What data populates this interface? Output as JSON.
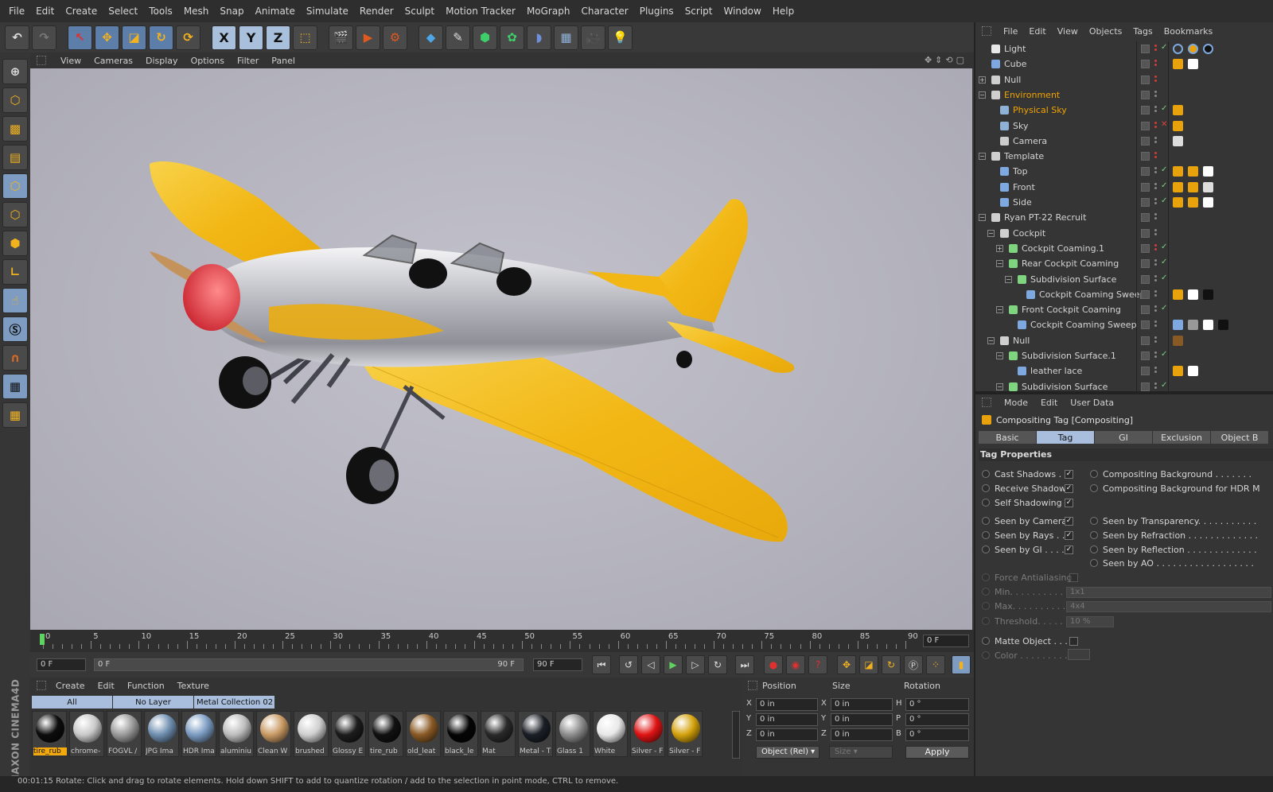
{
  "menubar": {
    "items": [
      "File",
      "Edit",
      "Create",
      "Select",
      "Tools",
      "Mesh",
      "Snap",
      "Animate",
      "Simulate",
      "Render",
      "Sculpt",
      "Motion Tracker",
      "MoGraph",
      "Character",
      "Plugins",
      "Script",
      "Window",
      "Help"
    ]
  },
  "toolbar": {
    "axes": [
      "X",
      "Y",
      "Z"
    ]
  },
  "brand": "MAXON CINEMA4D",
  "viewport": {
    "menu": [
      "View",
      "Cameras",
      "Display",
      "Options",
      "Filter",
      "Panel"
    ]
  },
  "timeline": {
    "ticks": [
      "0",
      "5",
      "10",
      "15",
      "20",
      "25",
      "30",
      "35",
      "40",
      "45",
      "50",
      "55",
      "60",
      "65",
      "70",
      "75",
      "80",
      "85",
      "90"
    ],
    "current_frame": "0 F"
  },
  "transport": {
    "start": "0 F",
    "slider_start": "0 F",
    "slider_end": "90 F",
    "end": "90 F"
  },
  "materials": {
    "menu": [
      "Create",
      "Edit",
      "Function",
      "Texture"
    ],
    "tabs": [
      "All",
      "No Layer",
      "Metal Collection 02"
    ],
    "items": [
      {
        "name": "tire_rub",
        "color": "#0d0d0d"
      },
      {
        "name": "chrome-",
        "color": "#c9c9c9"
      },
      {
        "name": "FOGVL /",
        "color": "#9a9a9a"
      },
      {
        "name": "JPG Ima",
        "color": "#6f8fb0"
      },
      {
        "name": "HDR Ima",
        "color": "#7b9cc2"
      },
      {
        "name": "aluminiu",
        "color": "#bdbdbd"
      },
      {
        "name": "Clean W",
        "color": "#c99a64"
      },
      {
        "name": "brushed",
        "color": "#cfcfcf"
      },
      {
        "name": "Glossy E",
        "color": "#1d1d1d"
      },
      {
        "name": "tire_rub",
        "color": "#111"
      },
      {
        "name": "old_leat",
        "color": "#8a5a25"
      },
      {
        "name": "black_le",
        "color": "#050505"
      },
      {
        "name": "Mat",
        "color": "#2a2a2a"
      },
      {
        "name": "Metal - T",
        "color": "#1b1f26"
      },
      {
        "name": "Glass 1",
        "color": "#8d8d8d"
      },
      {
        "name": "White",
        "color": "#e8e8e8"
      },
      {
        "name": "Silver - F",
        "color": "#e01414"
      },
      {
        "name": "Silver - F",
        "color": "#d4a20c"
      }
    ]
  },
  "coords": {
    "headers": [
      "Position",
      "Size",
      "Rotation"
    ],
    "rows": [
      {
        "a": "X",
        "av": "0 in",
        "b": "X",
        "bv": "0 in",
        "c": "H",
        "cv": "0 °"
      },
      {
        "a": "Y",
        "av": "0 in",
        "b": "Y",
        "bv": "0 in",
        "c": "P",
        "cv": "0 °"
      },
      {
        "a": "Z",
        "av": "0 in",
        "b": "Z",
        "bv": "0 in",
        "c": "B",
        "cv": "0 °"
      }
    ],
    "mode": "Object (Rel)",
    "size_mode": "Size",
    "apply": "Apply"
  },
  "status": "00:01:15   Rotate: Click and drag to rotate elements. Hold down SHIFT to add to quantize rotation / add to the selection in point mode, CTRL to remove.",
  "objects": {
    "menu": [
      "File",
      "Edit",
      "View",
      "Objects",
      "Tags",
      "Bookmarks"
    ],
    "rows": [
      {
        "name": "Light",
        "indent": 0,
        "icon": "#e8e8e8",
        "hl": false,
        "exp": ""
      },
      {
        "name": "Cube",
        "indent": 0,
        "icon": "#7ea9e0",
        "hl": false,
        "exp": ""
      },
      {
        "name": "Null",
        "indent": 0,
        "icon": "#cfcfcf",
        "hl": false,
        "exp": "+"
      },
      {
        "name": "Environment",
        "indent": 0,
        "icon": "#cfcfcf",
        "hl": true,
        "exp": "-"
      },
      {
        "name": "Physical Sky",
        "indent": 1,
        "icon": "#8fb1d6",
        "hl": true,
        "exp": ""
      },
      {
        "name": "Sky",
        "indent": 1,
        "icon": "#8fb1d6",
        "hl": false,
        "exp": ""
      },
      {
        "name": "Camera",
        "indent": 1,
        "icon": "#cccccc",
        "hl": false,
        "exp": ""
      },
      {
        "name": "Template",
        "indent": 0,
        "icon": "#cfcfcf",
        "hl": false,
        "exp": "-"
      },
      {
        "name": "Top",
        "indent": 1,
        "icon": "#7ea9e0",
        "hl": false,
        "exp": ""
      },
      {
        "name": "Front",
        "indent": 1,
        "icon": "#7ea9e0",
        "hl": false,
        "exp": ""
      },
      {
        "name": "Side",
        "indent": 1,
        "icon": "#7ea9e0",
        "hl": false,
        "exp": ""
      },
      {
        "name": "Ryan PT-22 Recruit",
        "indent": 0,
        "icon": "#cfcfcf",
        "hl": false,
        "exp": "-"
      },
      {
        "name": "Cockpit",
        "indent": 1,
        "icon": "#cfcfcf",
        "hl": false,
        "exp": "-"
      },
      {
        "name": "Cockpit Coaming.1",
        "indent": 2,
        "icon": "#7fd47f",
        "hl": false,
        "exp": "+"
      },
      {
        "name": "Rear Cockpit Coaming",
        "indent": 2,
        "icon": "#7fd47f",
        "hl": false,
        "exp": "-"
      },
      {
        "name": "Subdivision Surface",
        "indent": 3,
        "icon": "#7fd47f",
        "hl": false,
        "exp": "-"
      },
      {
        "name": "Cockpit Coaming Sweep",
        "indent": 4,
        "icon": "#7ea9e0",
        "hl": false,
        "exp": ""
      },
      {
        "name": "Front Cockpit Coaming",
        "indent": 2,
        "icon": "#7fd47f",
        "hl": false,
        "exp": "-"
      },
      {
        "name": "Cockpit Coaming Sweep",
        "indent": 3,
        "icon": "#7ea9e0",
        "hl": false,
        "exp": ""
      },
      {
        "name": "Null",
        "indent": 1,
        "icon": "#cfcfcf",
        "hl": false,
        "exp": "-"
      },
      {
        "name": "Subdivision Surface.1",
        "indent": 2,
        "icon": "#7fd47f",
        "hl": false,
        "exp": "-"
      },
      {
        "name": "leather lace",
        "indent": 3,
        "icon": "#7ea9e0",
        "hl": false,
        "exp": ""
      },
      {
        "name": "Subdivision Surface",
        "indent": 2,
        "icon": "#7fd47f",
        "hl": false,
        "exp": "-"
      }
    ]
  },
  "attributes": {
    "menu": [
      "Mode",
      "Edit",
      "User Data"
    ],
    "title": "Compositing Tag [Compositing]",
    "tabs": [
      "Basic",
      "Tag",
      "GI",
      "Exclusion",
      "Object B"
    ],
    "active_tab": "Tag",
    "section": "Tag Properties",
    "left_props": [
      {
        "label": "Cast Shadows . .",
        "checked": true
      },
      {
        "label": "Receive Shadows",
        "checked": true
      },
      {
        "label": "Self Shadowing",
        "checked": true
      },
      {
        "label": "Seen by Camera",
        "checked": true
      },
      {
        "label": "Seen by Rays . . .",
        "checked": true
      },
      {
        "label": "Seen by GI . . . . .",
        "checked": true
      }
    ],
    "right_props": [
      "Compositing Background . . . . . . .",
      "Compositing Background for HDR M",
      "Seen by Transparency. . . . . . . . . . .",
      "Seen by Refraction . . . . . . . . . . . . .",
      "Seen by Reflection . . . . . . . . . . . . .",
      "Seen by AO . . . . . . . . . . . . . . . . . ."
    ],
    "force_aa": "Force Antialiasing",
    "min_label": "Min. . . . . . . . . . . .",
    "min_value": "1x1",
    "max_label": "Max. . . . . . . . . . . .",
    "max_value": "4x4",
    "threshold_label": "Threshold. . . . . . .",
    "threshold_value": "10 %",
    "matte": "Matte Object . . . .",
    "color": "Color . . . . . . . . ."
  }
}
